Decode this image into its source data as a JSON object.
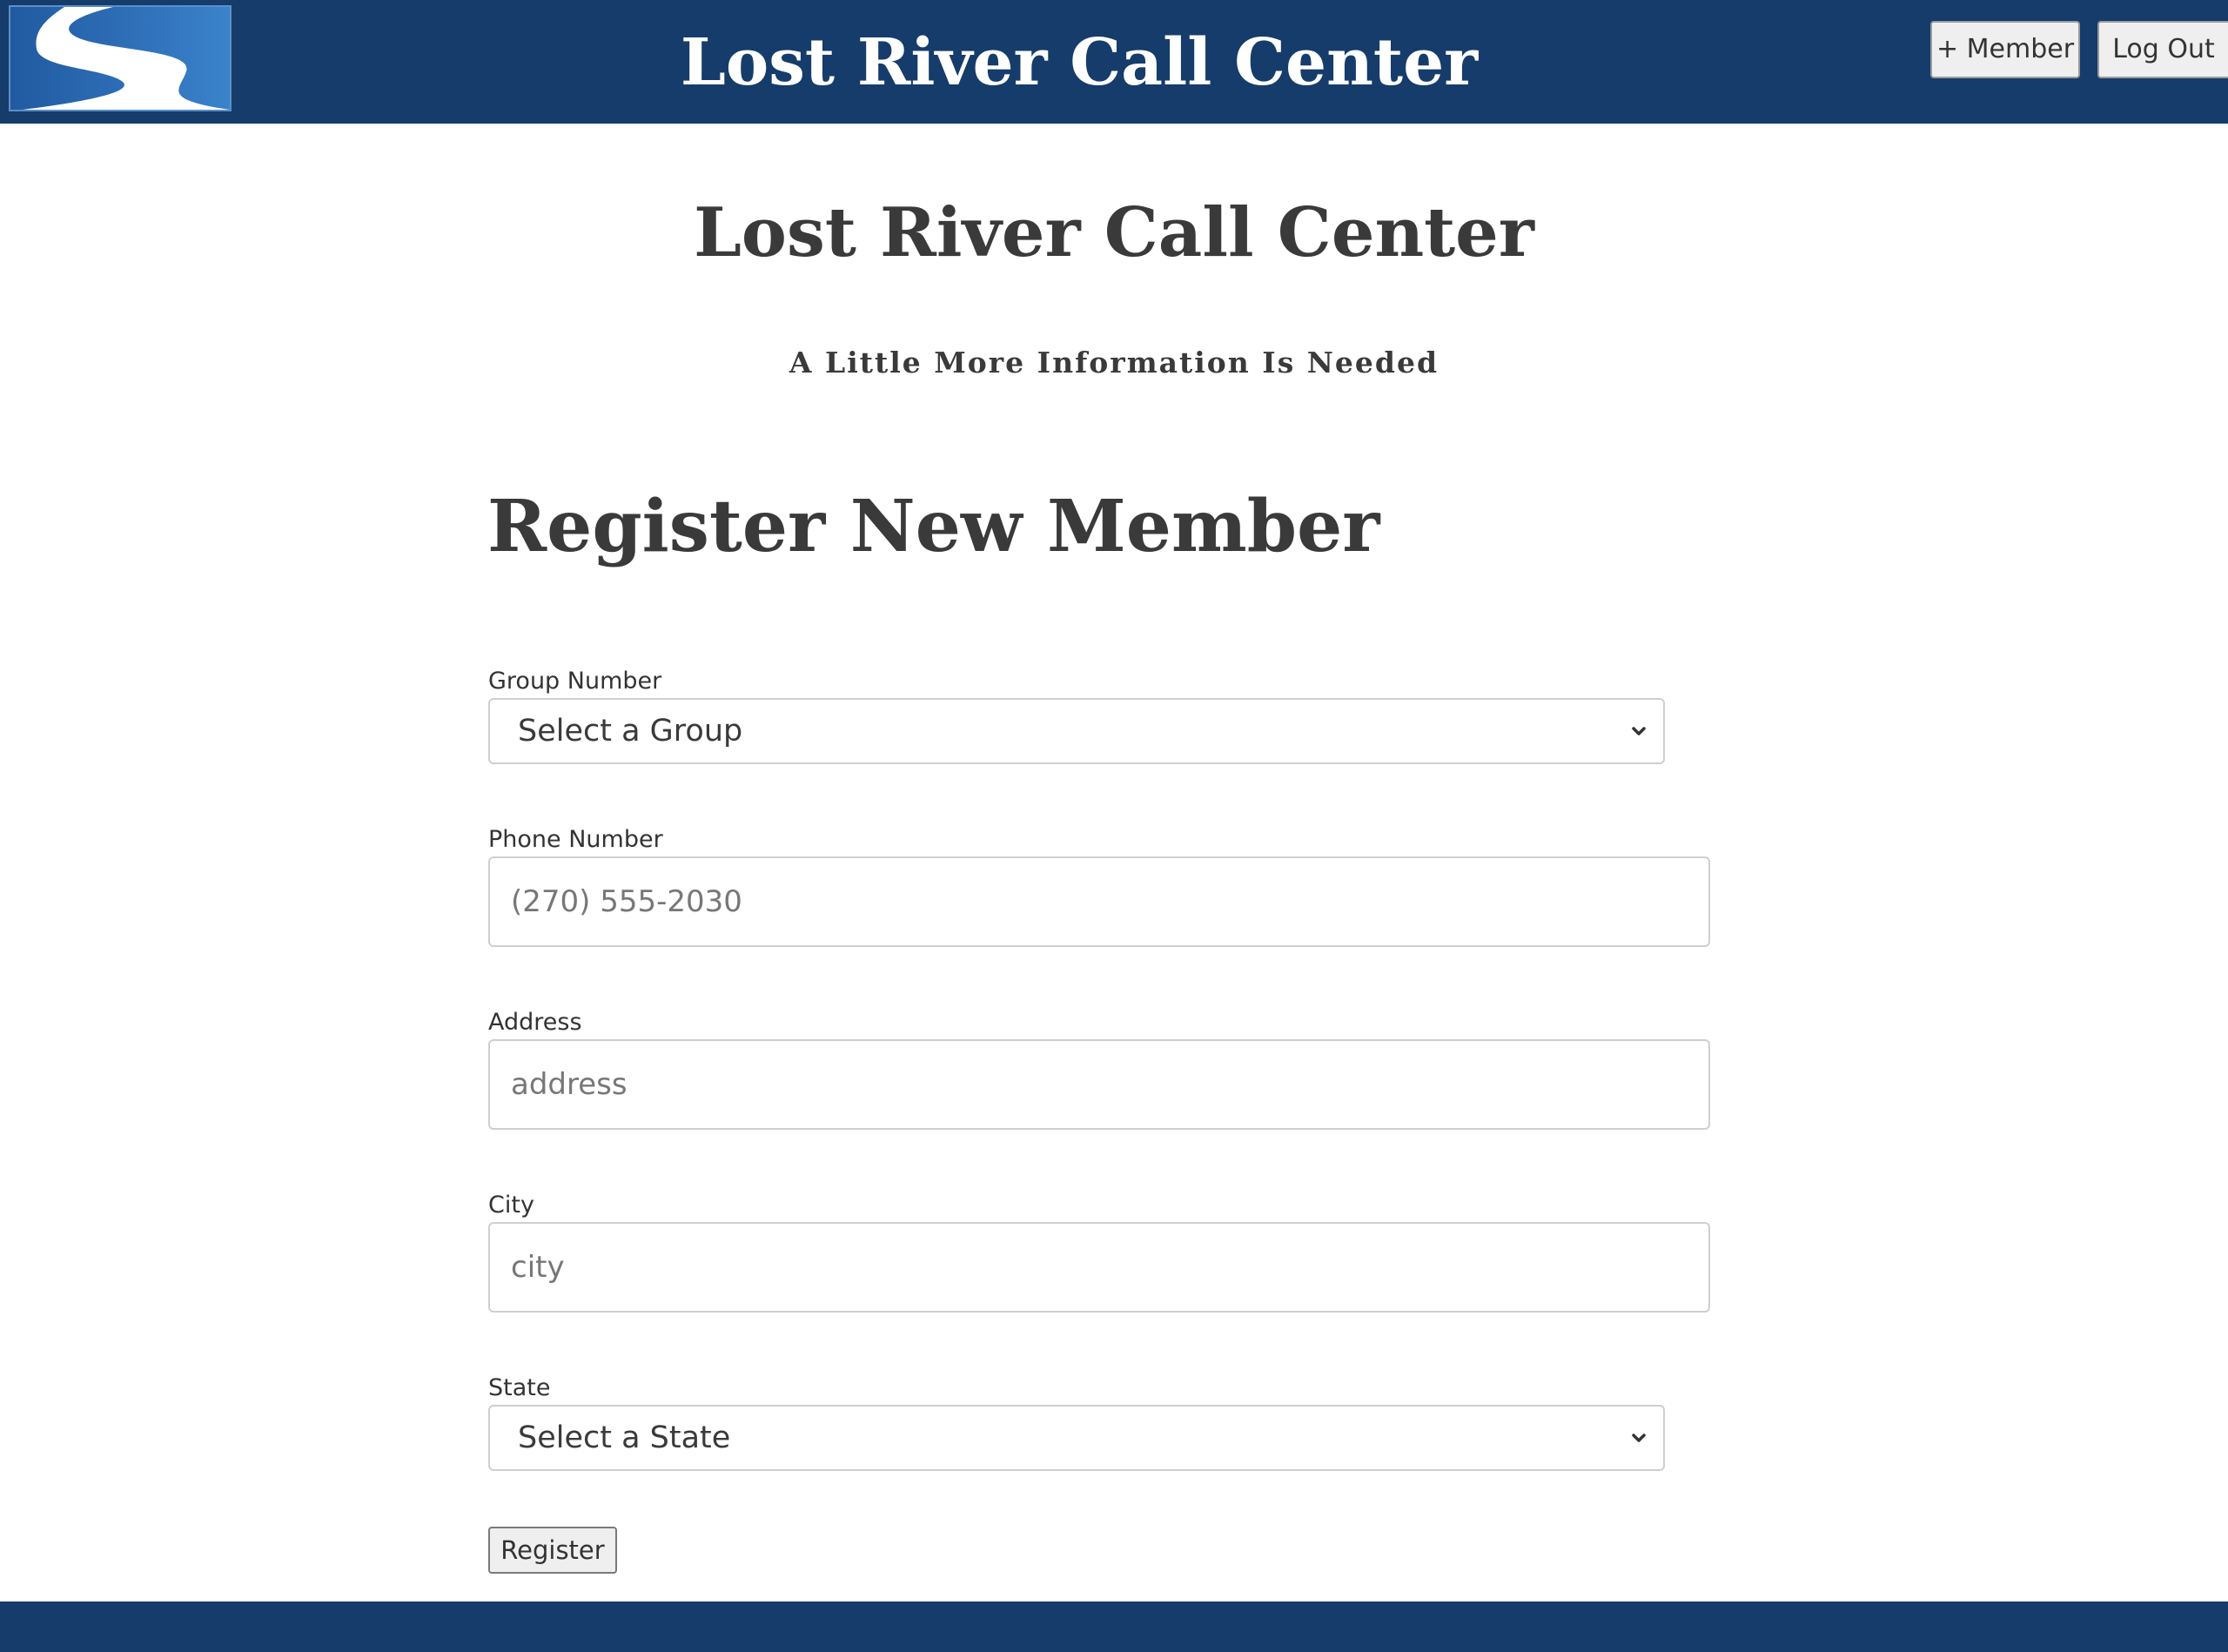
{
  "header": {
    "title": "Lost River Call Center",
    "add_member_label": "+ Member",
    "logout_label": "Log Out"
  },
  "page": {
    "title": "Lost River Call Center",
    "subtitle": "A Little More Information Is Needed"
  },
  "form": {
    "title": "Register New Member",
    "group": {
      "label": "Group Number",
      "selected": "Select a Group"
    },
    "phone": {
      "label": "Phone Number",
      "placeholder": "(270) 555-2030",
      "value": ""
    },
    "address": {
      "label": "Address",
      "placeholder": "address",
      "value": ""
    },
    "city": {
      "label": "City",
      "placeholder": "city",
      "value": ""
    },
    "state": {
      "label": "State",
      "selected": "Select a State"
    },
    "submit_label": "Register"
  },
  "colors": {
    "header_bg": "#153c6a",
    "text": "#3a3a3a",
    "logo_blue": "#2e6fb8"
  },
  "icons": {
    "logo": "river-logo-icon",
    "dropdown": "chevron-down-icon"
  }
}
